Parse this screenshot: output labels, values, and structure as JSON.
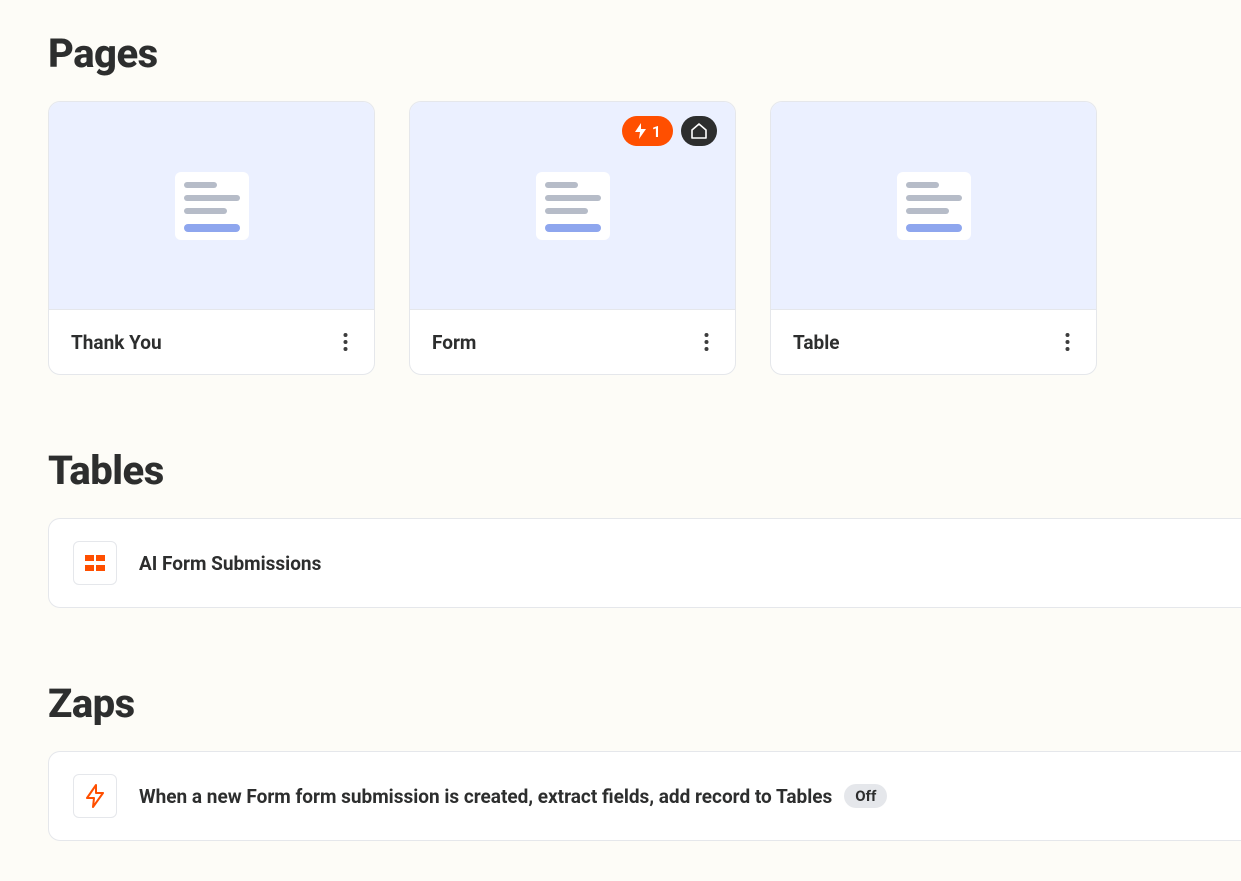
{
  "sections": {
    "pages_title": "Pages",
    "tables_title": "Tables",
    "zaps_title": "Zaps"
  },
  "pages": [
    {
      "title": "Thank You",
      "badge_count": null,
      "is_home": false
    },
    {
      "title": "Form",
      "badge_count": "1",
      "is_home": true
    },
    {
      "title": "Table",
      "badge_count": null,
      "is_home": false
    }
  ],
  "tables": [
    {
      "title": "AI Form Submissions"
    }
  ],
  "zaps": [
    {
      "title": "When a new Form form submission is created, extract fields, add record to Tables",
      "status": "Off"
    }
  ]
}
